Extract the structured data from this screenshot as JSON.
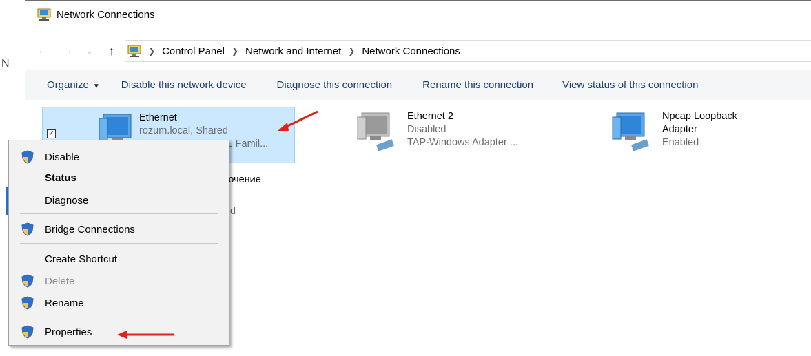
{
  "window": {
    "title": "Network Connections"
  },
  "background": {
    "fragment_letter": "N"
  },
  "address": {
    "breadcrumbs": [
      "Control Panel",
      "Network and Internet",
      "Network Connections"
    ]
  },
  "toolbar": {
    "organize": "Organize",
    "disable_device": "Disable this network device",
    "diagnose": "Diagnose this connection",
    "rename": "Rename this connection",
    "view_status": "View status of this connection"
  },
  "connections": [
    {
      "name": "Ethernet",
      "line1": "rozum.local, Shared",
      "line2_visible": "GBE Famil..."
    },
    {
      "name": "Ethernet 2",
      "line1": "Disabled",
      "line2": "TAP-Windows Adapter ..."
    },
    {
      "name_line1": "Npcap Loopback",
      "name_line2": "Adapter",
      "line1": "Enabled"
    }
  ],
  "partial_item": {
    "name_visible": "лючение",
    "sub_visible": "d"
  },
  "context_menu": {
    "items": [
      {
        "label": "Disable",
        "shield": true
      },
      {
        "label": "Status",
        "bold": true
      },
      {
        "label": "Diagnose"
      },
      {
        "label": "Bridge Connections",
        "shield": true
      },
      {
        "label": "Create Shortcut"
      },
      {
        "label": "Delete",
        "shield": true,
        "disabled": true
      },
      {
        "label": "Rename",
        "shield": true
      },
      {
        "label": "Properties",
        "shield": true
      }
    ]
  },
  "colors": {
    "selection_bg": "#cce8ff",
    "selection_border": "#99d1ff",
    "toolbar_text": "#1b3c72",
    "annotation_arrow": "#e0201b"
  }
}
